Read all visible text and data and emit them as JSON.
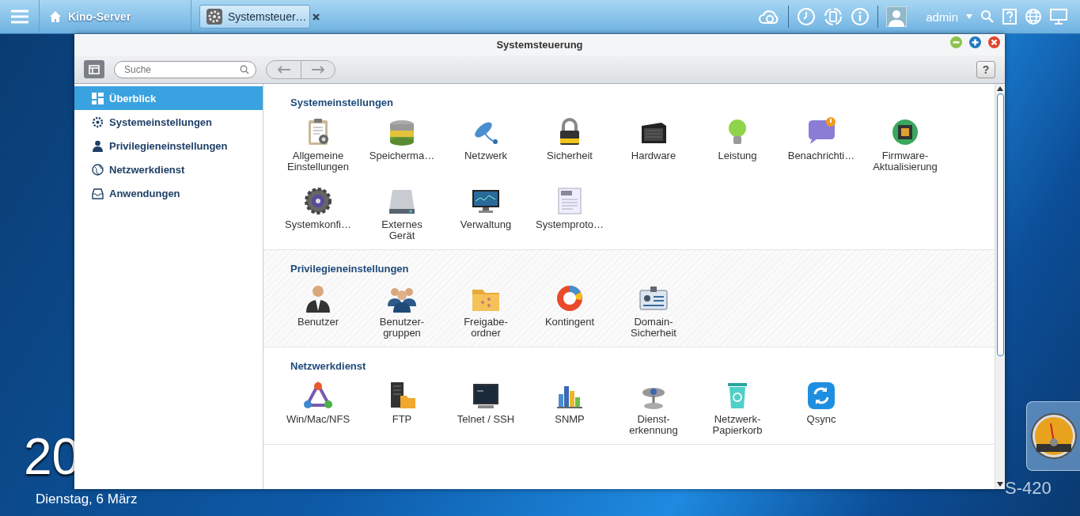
{
  "taskbar": {
    "app_title": "Kino-Server",
    "tasks": [
      {
        "label": "Systemsteuer…",
        "selected": true
      }
    ],
    "user": "admin"
  },
  "desktop": {
    "clock": "20",
    "date": "Dienstag, 6 März",
    "device_name": "S-420"
  },
  "window": {
    "title": "Systemsteuerung",
    "search": {
      "placeholder": "Suche"
    },
    "help_button": "?"
  },
  "sidebar": {
    "items": [
      {
        "label": "Überblick",
        "selected": true
      },
      {
        "label": "Systemeinstellungen",
        "selected": false
      },
      {
        "label": "Privilegieneinstellungen",
        "selected": false
      },
      {
        "label": "Netzwerkdienst",
        "selected": false
      },
      {
        "label": "Anwendungen",
        "selected": false
      }
    ]
  },
  "sections": [
    {
      "heading": "Systemeinstellungen",
      "items": [
        {
          "label": "Allgemeine\nEinstellungen"
        },
        {
          "label": "Speicherma…"
        },
        {
          "label": "Netzwerk"
        },
        {
          "label": "Sicherheit"
        },
        {
          "label": "Hardware"
        },
        {
          "label": "Leistung"
        },
        {
          "label": "Benachrichti…"
        },
        {
          "label": "Firmware-\nAktualisierung"
        },
        {
          "label": "Systemkonfi…"
        },
        {
          "label": "Externes\nGerät"
        },
        {
          "label": "Verwaltung"
        },
        {
          "label": "Systemproto…"
        }
      ]
    },
    {
      "heading": "Privilegieneinstellungen",
      "items": [
        {
          "label": "Benutzer"
        },
        {
          "label": "Benutzer-\ngruppen"
        },
        {
          "label": "Freigabe-\nordner"
        },
        {
          "label": "Kontingent"
        },
        {
          "label": "Domain-\nSicherheit"
        }
      ]
    },
    {
      "heading": "Netzwerkdienst",
      "items": [
        {
          "label": "Win/Mac/NFS"
        },
        {
          "label": "FTP"
        },
        {
          "label": "Telnet / SSH"
        },
        {
          "label": "SNMP"
        },
        {
          "label": "Dienst-\nerkennung"
        },
        {
          "label": "Netzwerk-\nPapierkorb"
        },
        {
          "label": "Qsync"
        }
      ]
    }
  ]
}
